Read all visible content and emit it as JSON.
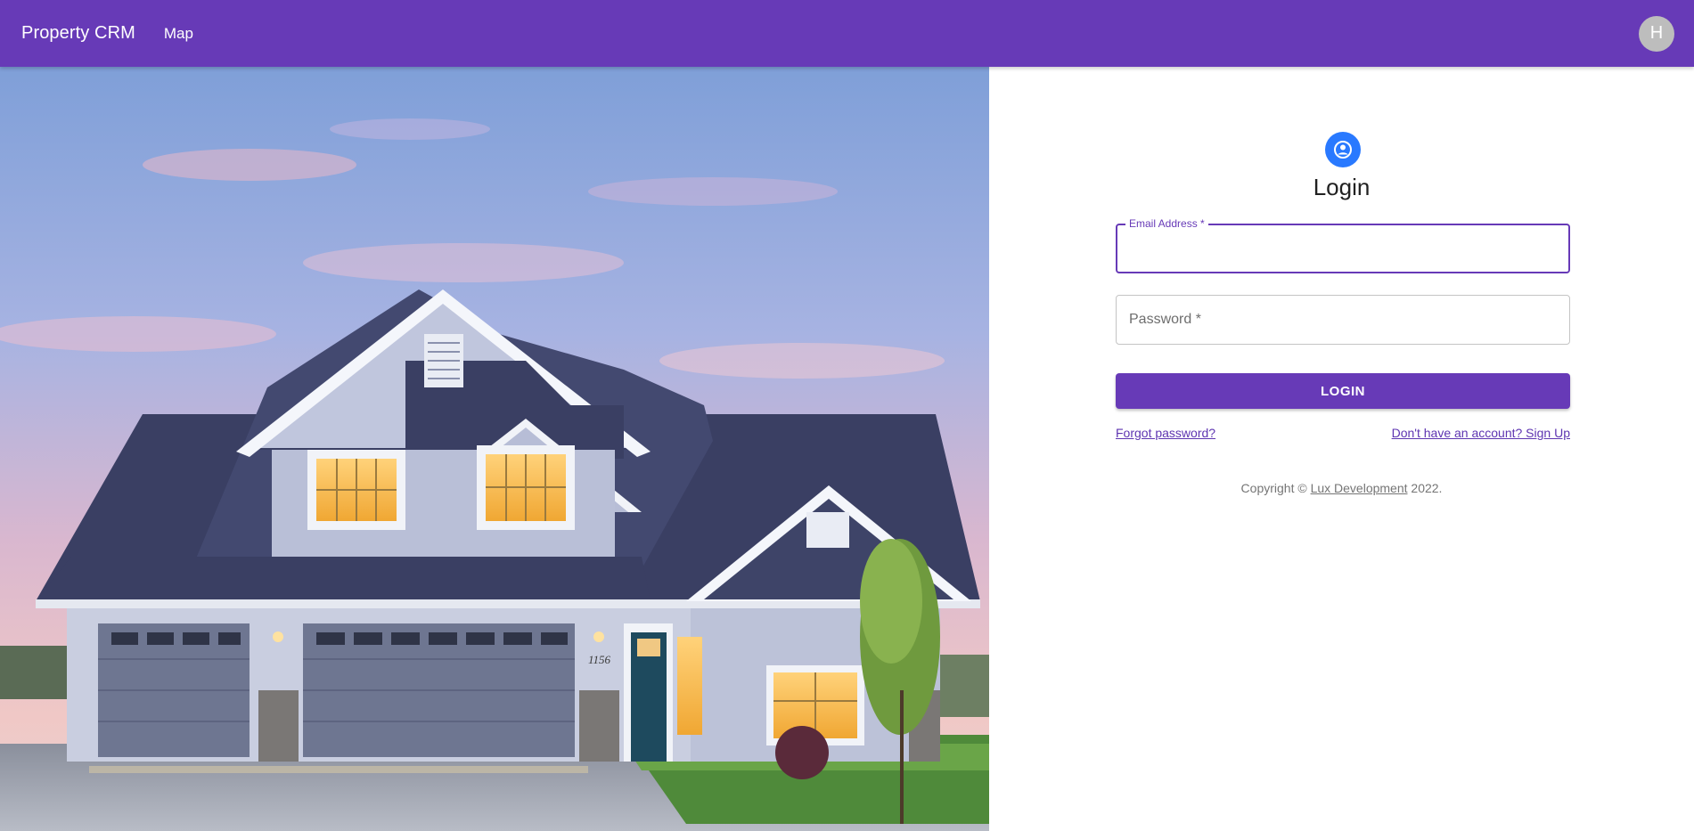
{
  "header": {
    "brand": "Property CRM",
    "nav_map": "Map",
    "avatar_initial": "H",
    "color": "#673ab7"
  },
  "hero": {
    "house_number": "1156"
  },
  "login": {
    "icon": "account-circle-icon",
    "title": "Login",
    "email_label": "Email Address *",
    "email_value": "",
    "password_placeholder": "Password *",
    "password_value": "",
    "submit_label": "LOGIN",
    "forgot_link": "Forgot password?",
    "signup_link": "Don't have an account? Sign Up",
    "copyright_prefix": "Copyright ©",
    "copyright_company": "Lux Development",
    "copyright_suffix": "2022."
  }
}
